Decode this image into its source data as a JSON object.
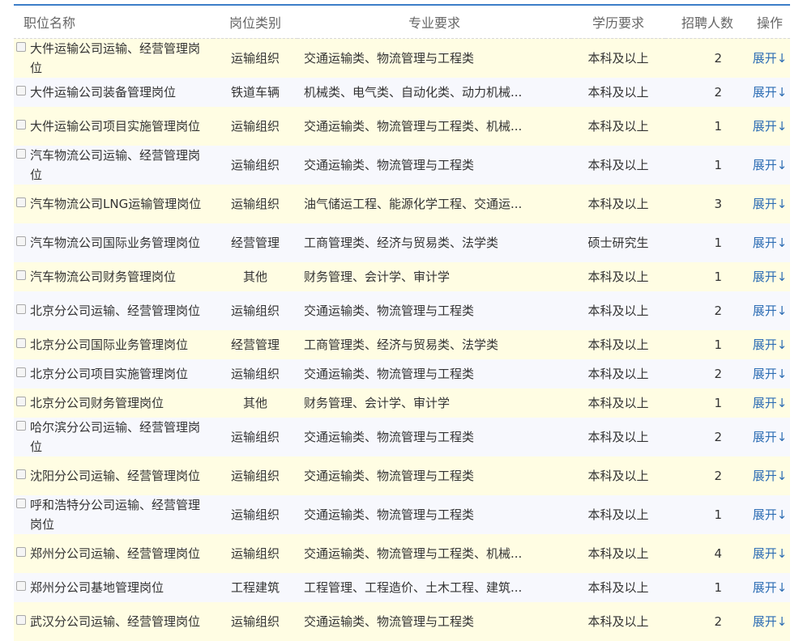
{
  "header": {
    "name": "职位名称",
    "category": "岗位类别",
    "major": "专业要求",
    "education": "学历要求",
    "count": "招聘人数",
    "action": "操作"
  },
  "rows": [
    {
      "name": "大件运输公司运输、经营管理岗位",
      "category": "运输组织",
      "major": "交通运输类、物流管理与工程类",
      "education": "本科及以上",
      "count": "2",
      "action": "展开↓"
    },
    {
      "name": "大件运输公司装备管理岗位",
      "category": "铁道车辆",
      "major": "机械类、电气类、自动化类、动力机械...",
      "education": "本科及以上",
      "count": "2",
      "action": "展开↓"
    },
    {
      "name": "大件运输公司项目实施管理岗位",
      "category": "运输组织",
      "major": "交通运输类、物流管理与工程类、机械...",
      "education": "本科及以上",
      "count": "1",
      "action": "展开↓"
    },
    {
      "name": "汽车物流公司运输、经营管理岗位",
      "category": "运输组织",
      "major": "交通运输类、物流管理与工程类",
      "education": "本科及以上",
      "count": "1",
      "action": "展开↓"
    },
    {
      "name": "汽车物流公司LNG运输管理岗位",
      "category": "运输组织",
      "major": "油气储运工程、能源化学工程、交通运...",
      "education": "本科及以上",
      "count": "3",
      "action": "展开↓"
    },
    {
      "name": "汽车物流公司国际业务管理岗位",
      "category": "经营管理",
      "major": "工商管理类、经济与贸易类、法学类",
      "education": "硕士研究生",
      "count": "1",
      "action": "展开↓"
    },
    {
      "name": "汽车物流公司财务管理岗位",
      "category": "其他",
      "major": "财务管理、会计学、审计学",
      "education": "本科及以上",
      "count": "1",
      "action": "展开↓"
    },
    {
      "name": "北京分公司运输、经营管理岗位",
      "category": "运输组织",
      "major": "交通运输类、物流管理与工程类",
      "education": "本科及以上",
      "count": "2",
      "action": "展开↓"
    },
    {
      "name": "北京分公司国际业务管理岗位",
      "category": "经营管理",
      "major": "工商管理类、经济与贸易类、法学类",
      "education": "本科及以上",
      "count": "1",
      "action": "展开↓"
    },
    {
      "name": "北京分公司项目实施管理岗位",
      "category": "运输组织",
      "major": "交通运输类、物流管理与工程类",
      "education": "本科及以上",
      "count": "2",
      "action": "展开↓"
    },
    {
      "name": "北京分公司财务管理岗位",
      "category": "其他",
      "major": "财务管理、会计学、审计学",
      "education": "本科及以上",
      "count": "1",
      "action": "展开↓"
    },
    {
      "name": "哈尔滨分公司运输、经营管理岗位",
      "category": "运输组织",
      "major": "交通运输类、物流管理与工程类",
      "education": "本科及以上",
      "count": "2",
      "action": "展开↓"
    },
    {
      "name": "沈阳分公司运输、经营管理岗位",
      "category": "运输组织",
      "major": "交通运输类、物流管理与工程类",
      "education": "本科及以上",
      "count": "2",
      "action": "展开↓"
    },
    {
      "name": "呼和浩特分公司运输、经营管理岗位",
      "category": "运输组织",
      "major": "交通运输类、物流管理与工程类",
      "education": "本科及以上",
      "count": "1",
      "action": "展开↓"
    },
    {
      "name": "郑州分公司运输、经营管理岗位",
      "category": "运输组织",
      "major": "交通运输类、物流管理与工程类、机械...",
      "education": "本科及以上",
      "count": "4",
      "action": "展开↓"
    },
    {
      "name": "郑州分公司基地管理岗位",
      "category": "工程建筑",
      "major": "工程管理、工程造价、土木工程、建筑...",
      "education": "本科及以上",
      "count": "1",
      "action": "展开↓"
    },
    {
      "name": "武汉分公司运输、经营管理岗位",
      "category": "运输组织",
      "major": "交通运输类、物流管理与工程类",
      "education": "本科及以上",
      "count": "2",
      "action": "展开↓"
    }
  ]
}
